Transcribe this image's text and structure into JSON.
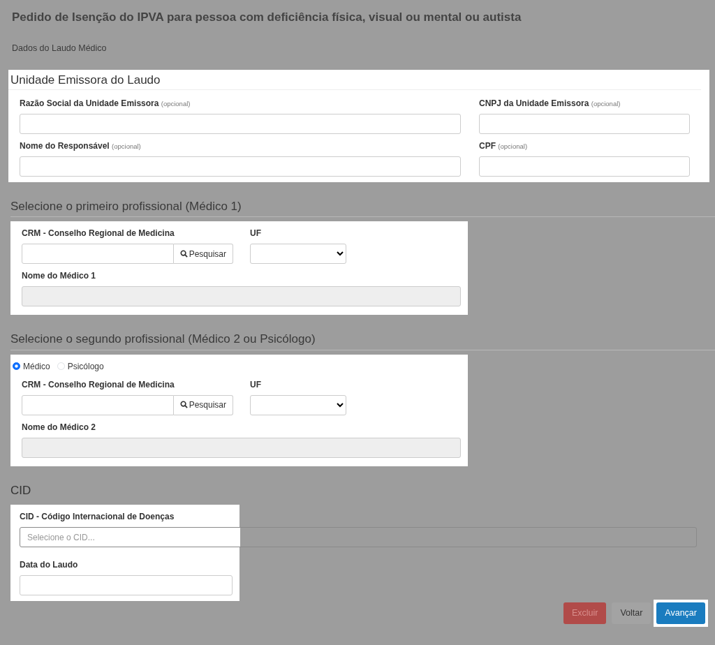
{
  "title": "Pedido de Isenção do IPVA para pessoa com deficiência física, visual ou mental ou autista",
  "subtitle": "Dados do Laudo Médico",
  "sections": [
    {
      "kind": "emissora",
      "heading": "Unidade Emissora do Laudo",
      "highlighted": true,
      "fields": [
        {
          "label": "Razão Social da Unidade Emissora",
          "hint": "(opcional)"
        },
        {
          "label": "CNPJ da Unidade Emissora",
          "hint": "(opcional)"
        },
        {
          "label": "Nome do Responsável",
          "hint": "(opcional)"
        },
        {
          "label": "CPF",
          "hint": "(opcional)"
        }
      ]
    },
    {
      "kind": "medico",
      "heading": "Selecione o primeiro profissional (Médico 1)",
      "highlighted": true,
      "crm_label": "CRM - Conselho Regional de Medicina",
      "search_button": "Pesquisar",
      "uf_label": "UF",
      "name_label": "Nome do Médico 1",
      "name_disabled": true
    },
    {
      "kind": "medico",
      "heading": "Selecione o segundo profissional (Médico 2 ou Psicólogo)",
      "highlighted": true,
      "radios": [
        {
          "label": "Médico",
          "selected": true
        },
        {
          "label": "Psicólogo",
          "selected": false
        }
      ],
      "crm_label": "CRM - Conselho Regional de Medicina",
      "search_button": "Pesquisar",
      "uf_label": "UF",
      "name_label": "Nome do Médico 2",
      "name_disabled": true
    },
    {
      "kind": "cid",
      "heading": "CID",
      "highlighted": true,
      "cid_label": "CID - Código Internacional de Doenças",
      "cid_placeholder": "Selecione o CID...",
      "date_label": "Data do Laudo"
    }
  ],
  "buttons": [
    {
      "label": "Excluir",
      "kind": "danger",
      "highlighted": false
    },
    {
      "label": "Voltar",
      "kind": "plain",
      "highlighted": false
    },
    {
      "label": "Avançar",
      "kind": "primary",
      "highlighted": true
    }
  ]
}
